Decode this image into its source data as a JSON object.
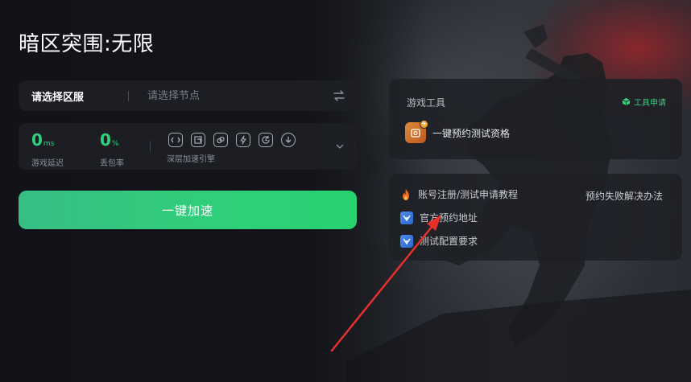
{
  "game": {
    "title": "暗区突围:无限"
  },
  "server": {
    "label": "请选择区服",
    "node_placeholder": "请选择节点",
    "swap_icon": "swap-arrows-icon"
  },
  "stats": {
    "latency": {
      "value": "0",
      "unit": "ms",
      "label": "游戏延迟"
    },
    "packet_loss": {
      "value": "0",
      "unit": "%",
      "label": "丢包率"
    },
    "engine_label": "深层加速引擎",
    "engine_icons": [
      "route-icon",
      "window-icon",
      "link-icon",
      "bolt-icon",
      "refresh-icon",
      "download-icon"
    ]
  },
  "accelerate": {
    "label": "一键加速"
  },
  "tools": {
    "title": "游戏工具",
    "apply_label": "工具申请",
    "item_label": "一键预约测试资格"
  },
  "guides": {
    "register_label": "账号注册/测试申请教程",
    "fail_label": "预约失败解决办法",
    "official_label": "官方预约地址",
    "config_label": "测试配置要求"
  },
  "colors": {
    "accent": "#30d07c",
    "button_start": "#37be84",
    "button_end": "#28d270",
    "annotation": "#e8302a"
  }
}
